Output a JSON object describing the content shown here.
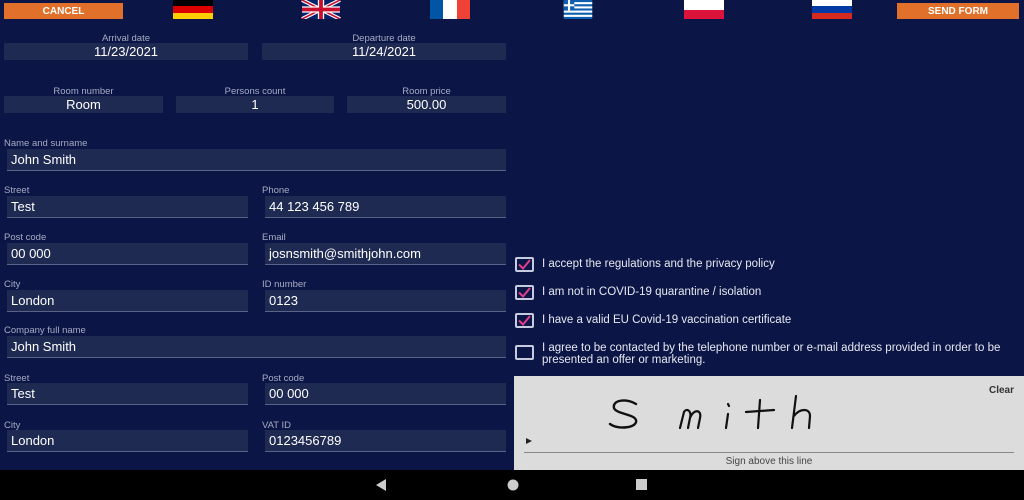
{
  "toolbar": {
    "cancel_label": "CANCEL",
    "send_label": "SEND FORM"
  },
  "languages": [
    {
      "name": "german-flag-icon",
      "colors": [
        "#000000",
        "#dd0000",
        "#ffce00"
      ]
    },
    {
      "name": "uk-flag-icon"
    },
    {
      "name": "french-flag-icon",
      "colors": [
        "#0055a4",
        "#ffffff",
        "#ef4135"
      ]
    },
    {
      "name": "greek-flag-icon"
    },
    {
      "name": "polish-flag-icon",
      "colors": [
        "#ffffff",
        "#dc143c"
      ]
    },
    {
      "name": "russian-flag-icon",
      "colors": [
        "#ffffff",
        "#0039a6",
        "#d52b1e"
      ]
    }
  ],
  "booking": {
    "arrival": {
      "label": "Arrival date",
      "value": "11/23/2021"
    },
    "departure": {
      "label": "Departure date",
      "value": "11/24/2021"
    },
    "room_number": {
      "label": "Room number",
      "value": "Room"
    },
    "persons": {
      "label": "Persons count",
      "value": "1"
    },
    "price": {
      "label": "Room price",
      "value": "500.00"
    }
  },
  "guest": {
    "name": {
      "label": "Name and surname",
      "value": "John Smith"
    },
    "street": {
      "label": "Street",
      "value": "Test"
    },
    "phone": {
      "label": "Phone",
      "value": "44 123 456 789"
    },
    "postcode": {
      "label": "Post code",
      "value": "00 000"
    },
    "email": {
      "label": "Email",
      "value": "josnsmith@smithjohn.com"
    },
    "city": {
      "label": "City",
      "value": "London"
    },
    "id_number": {
      "label": "ID number",
      "value": "0123"
    }
  },
  "company": {
    "name": {
      "label": "Company full name",
      "value": "John Smith"
    },
    "street": {
      "label": "Street",
      "value": "Test"
    },
    "postcode": {
      "label": "Post code",
      "value": "00 000"
    },
    "city": {
      "label": "City",
      "value": "London"
    },
    "vat": {
      "label": "VAT ID",
      "value": "0123456789"
    }
  },
  "consents": [
    {
      "text": "I accept the regulations and the privacy policy",
      "checked": true
    },
    {
      "text": "I am not in COVID-19 quarantine / isolation",
      "checked": true
    },
    {
      "text": "I have a valid EU Covid-19 vaccination certificate",
      "checked": true
    },
    {
      "text": "I agree to be contacted by the telephone number or e-mail address provided in order to be presented an offer or marketing.",
      "checked": false
    }
  ],
  "signature": {
    "clear_label": "Clear",
    "hint": "Sign above this line",
    "signed_text": "Smith"
  },
  "colors": {
    "background": "#0c1646",
    "field": "#1f2a52",
    "accent": "#e0702a",
    "check": "#e0408a"
  }
}
